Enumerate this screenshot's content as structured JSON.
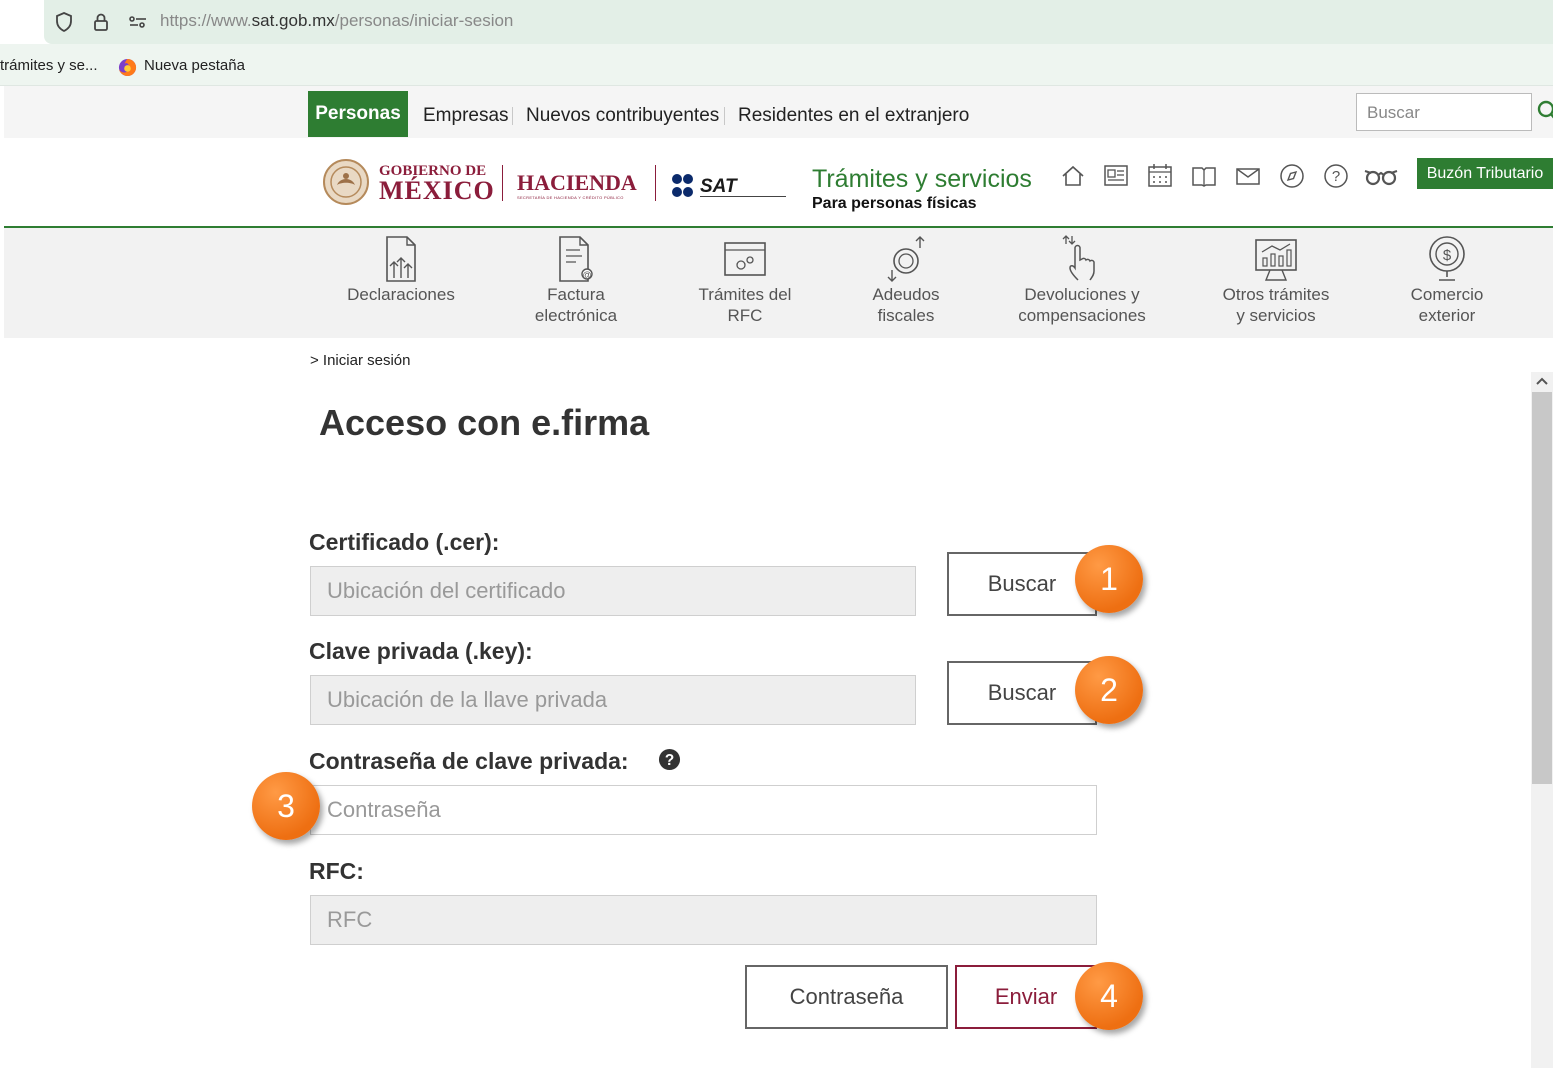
{
  "browser": {
    "url_prefix": "https://www.",
    "url_host": "sat.gob.mx",
    "url_path": "/personas/iniciar-sesion",
    "bookmarks": [
      "trámites y se...",
      "Nueva pestaña"
    ]
  },
  "topnav": {
    "items": [
      "Personas",
      "Empresas",
      "Nuevos contribuyentes",
      "Residentes en el extranjero"
    ],
    "search_placeholder": "Buscar"
  },
  "header": {
    "gob_line1": "GOBIERNO DE",
    "gob_line2": "MÉXICO",
    "hacienda": "HACIENDA",
    "hacienda_sub": "SECRETARÍA DE HACIENDA Y CRÉDITO PÚBLICO",
    "sat": "SAT",
    "section_title": "Trámites y servicios",
    "section_sub": "Para personas físicas",
    "buzon": "Buzón Tributario",
    "icons": [
      "home-icon",
      "news-icon",
      "calendar-icon",
      "book-icon",
      "mail-icon",
      "compass-icon",
      "help-icon",
      "glasses-icon"
    ]
  },
  "services": [
    {
      "label": "Declaraciones",
      "icon": "declaraciones-icon"
    },
    {
      "label": "Factura\nelectrónica",
      "icon": "factura-icon"
    },
    {
      "label": "Trámites del\nRFC",
      "icon": "rfc-icon"
    },
    {
      "label": "Adeudos\nfiscales",
      "icon": "adeudos-icon"
    },
    {
      "label": "Devoluciones y\ncompensaciones",
      "icon": "devoluciones-icon"
    },
    {
      "label": "Otros trámites\ny servicios",
      "icon": "otros-icon"
    },
    {
      "label": "Comercio\nexterior",
      "icon": "comercio-icon"
    }
  ],
  "breadcrumb": "> Iniciar sesión",
  "page_title": "Acceso con e.firma",
  "form": {
    "cer_label": "Certificado (.cer):",
    "cer_placeholder": "Ubicación del certificado",
    "key_label": "Clave privada (.key):",
    "key_placeholder": "Ubicación de la llave privada",
    "pwd_label": "Contraseña de clave privada:",
    "pwd_placeholder": "Contraseña",
    "rfc_label": "RFC:",
    "rfc_placeholder": "RFC",
    "buscar_label": "Buscar",
    "contrasena_button": "Contraseña",
    "enviar_button": "Enviar"
  },
  "steps": [
    "1",
    "2",
    "3",
    "4"
  ],
  "colors": {
    "green": "#2e7d32",
    "guinda": "#8b1d3b",
    "step_orange": "#ee6f12"
  }
}
